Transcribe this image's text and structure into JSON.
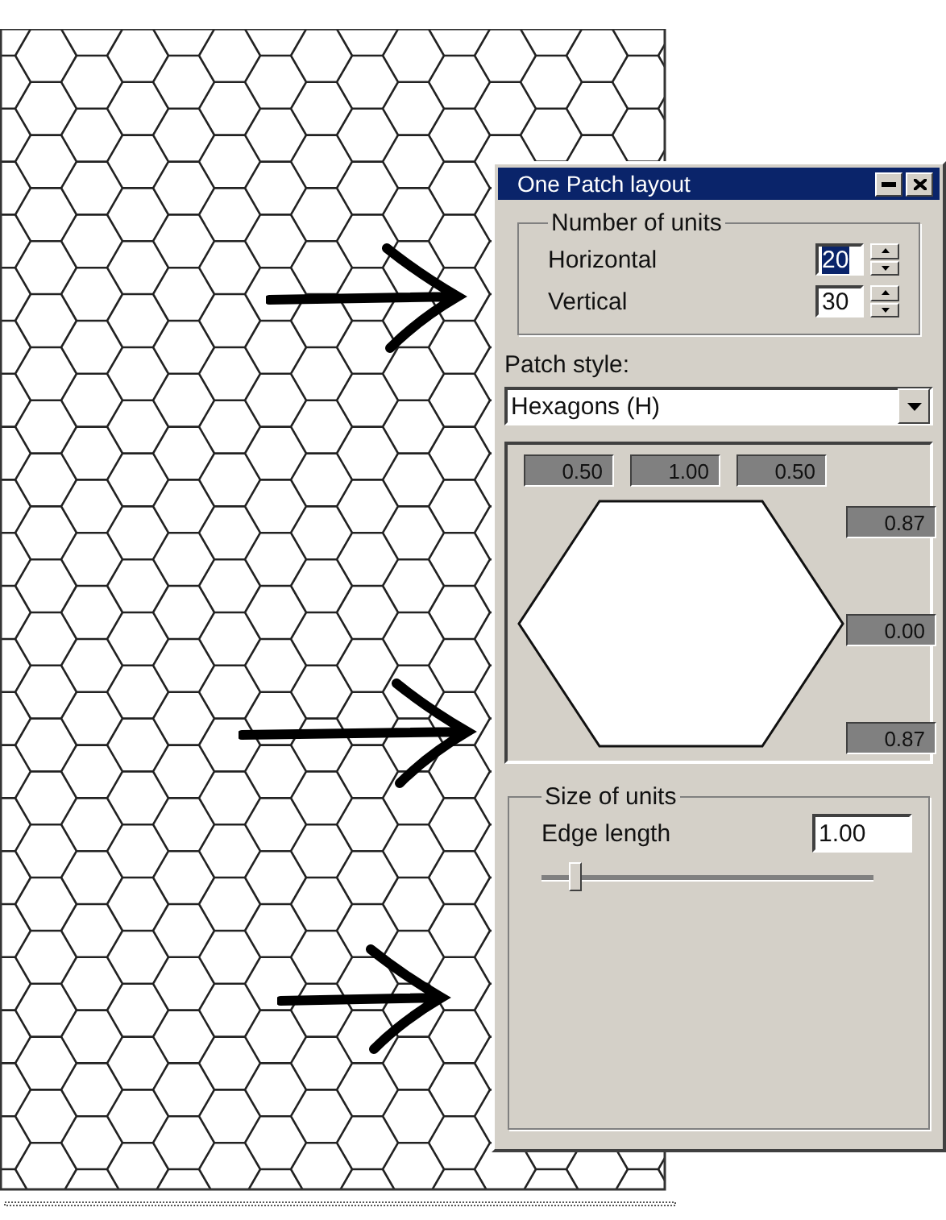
{
  "window": {
    "title": "One Patch layout"
  },
  "number_of_units": {
    "title": "Number of units",
    "fields": [
      {
        "label": "Horizontal",
        "value": "20",
        "selected": true
      },
      {
        "label": "Vertical",
        "value": "30",
        "selected": false
      }
    ]
  },
  "patch_style": {
    "label": "Patch style:",
    "value": "Hexagons (H)"
  },
  "preview": {
    "top_values": [
      "0.50",
      "1.00",
      "0.50"
    ],
    "side_values": [
      "0.87",
      "0.00",
      "0.87"
    ]
  },
  "size_of_units": {
    "title": "Size of units",
    "label": "Edge length",
    "value": "1.00",
    "level": 0.1
  }
}
